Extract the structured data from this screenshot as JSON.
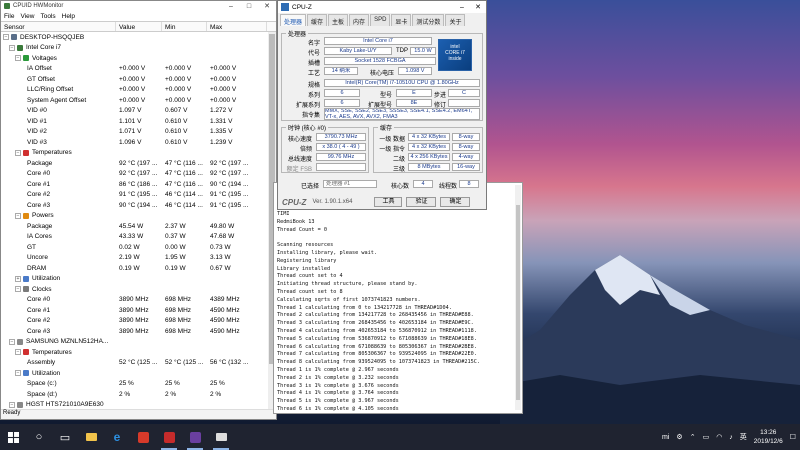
{
  "hwmonitor": {
    "title": "CPUID HWMonitor",
    "menu": [
      "File",
      "View",
      "Tools",
      "Help"
    ],
    "columns": [
      "Sensor",
      "Value",
      "Min",
      "Max"
    ],
    "status": "Ready",
    "rows": [
      {
        "indent": 0,
        "exp": "−",
        "icon": "computer-icon",
        "color": "#5a6f8a",
        "label": "DESKTOP-HSQQJEB",
        "value": "",
        "min": "",
        "max": ""
      },
      {
        "indent": 1,
        "exp": "−",
        "icon": "cpu-icon",
        "color": "#3a7a3a",
        "label": "Intel Core i7",
        "value": "",
        "min": "",
        "max": ""
      },
      {
        "indent": 2,
        "exp": "−",
        "icon": "voltage-icon",
        "color": "#2a9a3a",
        "label": "Voltages",
        "value": "",
        "min": "",
        "max": ""
      },
      {
        "indent": 4,
        "label": "IA Offset",
        "value": "+0.000 V",
        "min": "+0.000 V",
        "max": "+0.000 V"
      },
      {
        "indent": 4,
        "label": "GT Offset",
        "value": "+0.000 V",
        "min": "+0.000 V",
        "max": "+0.000 V"
      },
      {
        "indent": 4,
        "label": "LLC/Ring Offset",
        "value": "+0.000 V",
        "min": "+0.000 V",
        "max": "+0.000 V"
      },
      {
        "indent": 4,
        "label": "System Agent Offset",
        "value": "+0.000 V",
        "min": "+0.000 V",
        "max": "+0.000 V"
      },
      {
        "indent": 4,
        "label": "VID #0",
        "value": "1.097 V",
        "min": "0.607 V",
        "max": "1.272 V"
      },
      {
        "indent": 4,
        "label": "VID #1",
        "value": "1.101 V",
        "min": "0.610 V",
        "max": "1.331 V"
      },
      {
        "indent": 4,
        "label": "VID #2",
        "value": "1.071 V",
        "min": "0.610 V",
        "max": "1.335 V"
      },
      {
        "indent": 4,
        "label": "VID #3",
        "value": "1.096 V",
        "min": "0.610 V",
        "max": "1.239 V"
      },
      {
        "indent": 2,
        "exp": "−",
        "icon": "temperature-icon",
        "color": "#d03030",
        "label": "Temperatures",
        "value": "",
        "min": "",
        "max": ""
      },
      {
        "indent": 4,
        "label": "Package",
        "value": "92 °C (197 ...",
        "min": "47 °C (116 ...",
        "max": "92 °C (197 ..."
      },
      {
        "indent": 4,
        "label": "Core #0",
        "value": "92 °C (197 ...",
        "min": "47 °C (116 ...",
        "max": "92 °C (197 ..."
      },
      {
        "indent": 4,
        "label": "Core #1",
        "value": "86 °C (186 ...",
        "min": "47 °C (116 ...",
        "max": "90 °C (194 ..."
      },
      {
        "indent": 4,
        "label": "Core #2",
        "value": "91 °C (195 ...",
        "min": "46 °C (114 ...",
        "max": "91 °C (195 ..."
      },
      {
        "indent": 4,
        "label": "Core #3",
        "value": "90 °C (194 ...",
        "min": "46 °C (114 ...",
        "max": "91 °C (195 ..."
      },
      {
        "indent": 2,
        "exp": "−",
        "icon": "power-icon",
        "color": "#e08a10",
        "label": "Powers",
        "value": "",
        "min": "",
        "max": ""
      },
      {
        "indent": 4,
        "label": "Package",
        "value": "45.54 W",
        "min": "2.37 W",
        "max": "49.80 W"
      },
      {
        "indent": 4,
        "label": "IA Cores",
        "value": "43.33 W",
        "min": "0.37 W",
        "max": "47.68 W"
      },
      {
        "indent": 4,
        "label": "GT",
        "value": "0.02 W",
        "min": "0.00 W",
        "max": "0.73 W"
      },
      {
        "indent": 4,
        "label": "Uncore",
        "value": "2.19 W",
        "min": "1.95 W",
        "max": "3.13 W"
      },
      {
        "indent": 4,
        "label": "DRAM",
        "value": "0.19 W",
        "min": "0.19 W",
        "max": "0.67 W"
      },
      {
        "indent": 2,
        "exp": "+",
        "icon": "utilization-icon",
        "color": "#4a7ac8",
        "label": "Utilization",
        "value": "",
        "min": "",
        "max": ""
      },
      {
        "indent": 2,
        "exp": "−",
        "icon": "clock-icon",
        "color": "#7a7a7a",
        "label": "Clocks",
        "value": "",
        "min": "",
        "max": ""
      },
      {
        "indent": 4,
        "label": "Core #0",
        "value": "3890 MHz",
        "min": "698 MHz",
        "max": "4389 MHz"
      },
      {
        "indent": 4,
        "label": "Core #1",
        "value": "3890 MHz",
        "min": "698 MHz",
        "max": "4590 MHz"
      },
      {
        "indent": 4,
        "label": "Core #2",
        "value": "3890 MHz",
        "min": "698 MHz",
        "max": "4590 MHz"
      },
      {
        "indent": 4,
        "label": "Core #3",
        "value": "3890 MHz",
        "min": "698 MHz",
        "max": "4590 MHz"
      },
      {
        "indent": 1,
        "exp": "−",
        "icon": "disk-icon",
        "color": "#888888",
        "label": "SAMSUNG MZNLN512HA...",
        "value": "",
        "min": "",
        "max": ""
      },
      {
        "indent": 2,
        "exp": "−",
        "icon": "temperature-icon",
        "color": "#d03030",
        "label": "Temperatures",
        "value": "",
        "min": "",
        "max": ""
      },
      {
        "indent": 4,
        "label": "Assembly",
        "value": "52 °C (125 ...",
        "min": "52 °C (125 ...",
        "max": "56 °C (132 ..."
      },
      {
        "indent": 2,
        "exp": "−",
        "icon": "utilization-icon",
        "color": "#4a7ac8",
        "label": "Utilization",
        "value": "",
        "min": "",
        "max": ""
      },
      {
        "indent": 4,
        "label": "Space (c:)",
        "value": "25 %",
        "min": "25 %",
        "max": "25 %"
      },
      {
        "indent": 4,
        "label": "Space (d:)",
        "value": "2 %",
        "min": "2 %",
        "max": "2 %"
      },
      {
        "indent": 1,
        "exp": "−",
        "icon": "disk-icon",
        "color": "#888888",
        "label": "HGST HTS721010A9E630",
        "value": "",
        "min": "",
        "max": ""
      }
    ]
  },
  "cpuz": {
    "title": "CPU-Z",
    "tabs": [
      "处理器",
      "缓存",
      "主板",
      "内存",
      "SPD",
      "显卡",
      "测试分数",
      "关于"
    ],
    "group_processor": "处理器",
    "labels": {
      "name": "名字",
      "codename": "代号",
      "package": "插槽",
      "tech": "工艺",
      "core_voltage": "核心电压",
      "spec": "规格",
      "family": "系列",
      "ext_family": "扩展系列",
      "instructions": "指令集",
      "model": "型号",
      "ext_model": "扩展型号",
      "stepping": "步进",
      "revision": "修订",
      "tdp": "TDP"
    },
    "values": {
      "name": "Intel Core i7",
      "codename": "Kaby Lake-U/Y",
      "tdp": "15.0 W",
      "package": "Socket 1528 FCBGA",
      "tech": "14 纳米",
      "core_voltage": "1.098 V",
      "spec": "Intel(R) Core(TM) i7-10510U CPU @ 1.80GHz",
      "family": "6",
      "model": "E",
      "stepping": "C",
      "ext_family": "6",
      "ext_model": "8E",
      "revision": "",
      "instructions": "MMX, SSE, SSE2, SSE3, SSSE3, SSE4.1, SSE4.2, EM64T, VT-x, AES, AVX, AVX2, FMA3"
    },
    "intel_badge": [
      "intel",
      "CORE i7",
      "inside"
    ],
    "clocks_group": "时钟 (核心 #0)",
    "clock_labels": {
      "core_speed": "核心速度",
      "multiplier": "倍频",
      "bus_speed": "总线速度",
      "rated_fsb": "额定 FSB"
    },
    "clock_values": {
      "core_speed": "3790.73 MHz",
      "multiplier": "x 38.0 ( 4 - 49 )",
      "bus_speed": "99.76 MHz",
      "rated_fsb": ""
    },
    "cache_group": "缓存",
    "cache": [
      {
        "label": "一级 数据",
        "size": "4 x 32 KBytes",
        "way": "8-way"
      },
      {
        "label": "一级 指令",
        "size": "4 x 32 KBytes",
        "way": "8-way"
      },
      {
        "label": "二级",
        "size": "4 x 256 KBytes",
        "way": "4-way"
      },
      {
        "label": "三级",
        "size": "8 MBytes",
        "way": "16-way"
      }
    ],
    "selected_label": "已选择",
    "selected_value": "处理器 #1",
    "cores_label": "核心数",
    "cores": "4",
    "threads_label": "线程数",
    "threads": "8",
    "brand": "CPU-Z",
    "version": "Ver. 1.90.1.x64",
    "tools_btn": "工具",
    "validate_btn": "验证",
    "ok_btn": "确定"
  },
  "console": {
    "lines": [
      "TIMI",
      "RedmiBook 13",
      "Thread Count = 0",
      "",
      "Scanning resources",
      "Installing library, please wait.",
      "Registering library",
      "Library installed",
      "Thread count set to 4",
      "Initiating thread structure, please stand by.",
      "Thread count set to 8",
      "Calculating sqrts of first 1073741823 numbers.",
      "Thread 1 calculating from 0 to 134217728 in THREAD#1D04.",
      "Thread 2 calculating from 134217728 to 268435456 in THREAD#E88.",
      "Thread 3 calculating from 268435456 to 402653184 in THREAD#E9C.",
      "Thread 4 calculating from 402653184 to 536870912 in THREAD#1118.",
      "Thread 5 calculating from 536870912 to 671088639 in THREAD#18E8.",
      "Thread 6 calculating from 671088639 to 805306367 in THREAD#2BE8.",
      "Thread 7 calculating from 805306367 to 939524095 in THREAD#22E0.",
      "Thread 8 calculating from 939524095 to 1073741823 in THREAD#215C.",
      "Thread 1 is 1% complete @ 2.967 seconds",
      "Thread 2 is 1% complete @ 3.232 seconds",
      "Thread 3 is 1% complete @ 3.676 seconds",
      "Thread 4 is 1% complete @ 3.764 seconds",
      "Thread 5 is 1% complete @ 3.967 seconds",
      "Thread 6 is 1% complete @ 4.105 seconds"
    ]
  },
  "taskbar": {
    "tray_label": "英",
    "time": "13:26",
    "date": "2019/12/6"
  }
}
